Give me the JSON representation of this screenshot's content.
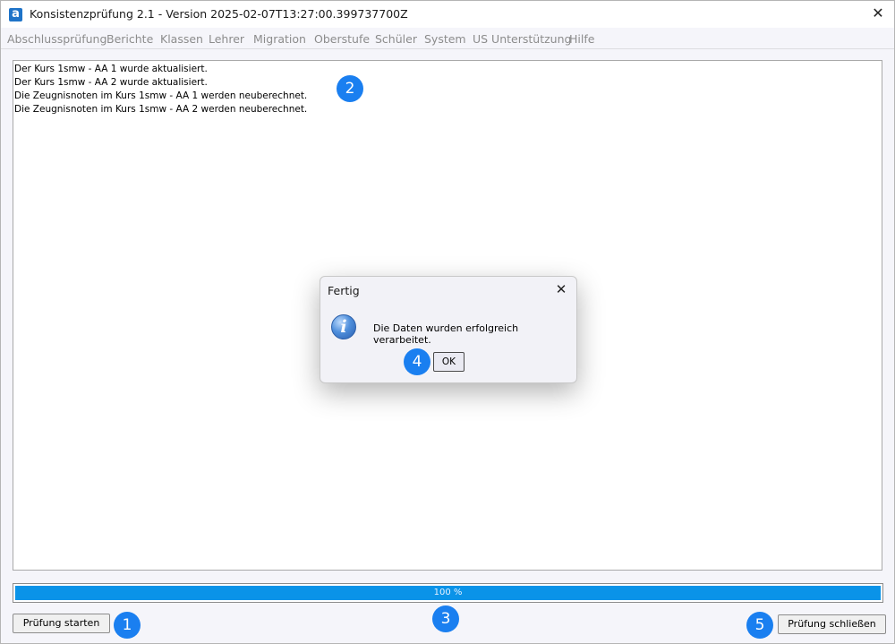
{
  "window": {
    "app_icon_letter": "a",
    "title": "Konsistenzprüfung 2.1 - Version 2025-02-07T13:27:00.399737700Z",
    "close_glyph": "✕"
  },
  "menu": {
    "items": [
      {
        "label": "Abschlussprüfung"
      },
      {
        "label": "Berichte"
      },
      {
        "label": "Klassen"
      },
      {
        "label": "Lehrer"
      },
      {
        "label": "Migration"
      },
      {
        "label": "Oberstufe"
      },
      {
        "label": "Schüler"
      },
      {
        "label": "System"
      },
      {
        "label": "US Unterstützung"
      },
      {
        "label": "Hilfe"
      }
    ]
  },
  "log": {
    "lines": [
      "Der Kurs 1smw - AA 1 wurde aktualisiert.",
      "Der Kurs 1smw - AA 2 wurde aktualisiert.",
      "Die Zeugnisnoten im Kurs 1smw - AA 1 werden neuberechnet.",
      "Die Zeugnisnoten im Kurs 1smw - AA 2 werden neuberechnet."
    ]
  },
  "progress": {
    "value_percent": 100,
    "label": "100 %",
    "color": "#0a93e8"
  },
  "buttons": {
    "start": "Prüfung starten",
    "close": "Prüfung schließen"
  },
  "dialog": {
    "title": "Fertig",
    "close_glyph": "✕",
    "icon": "info-icon",
    "icon_glyph": "i",
    "message": "Die Daten wurden erfolgreich verarbeitet.",
    "ok": "OK"
  },
  "badges": {
    "b1": "1",
    "b2": "2",
    "b3": "3",
    "b4": "4",
    "b5": "5",
    "color": "#1a7ff0"
  }
}
